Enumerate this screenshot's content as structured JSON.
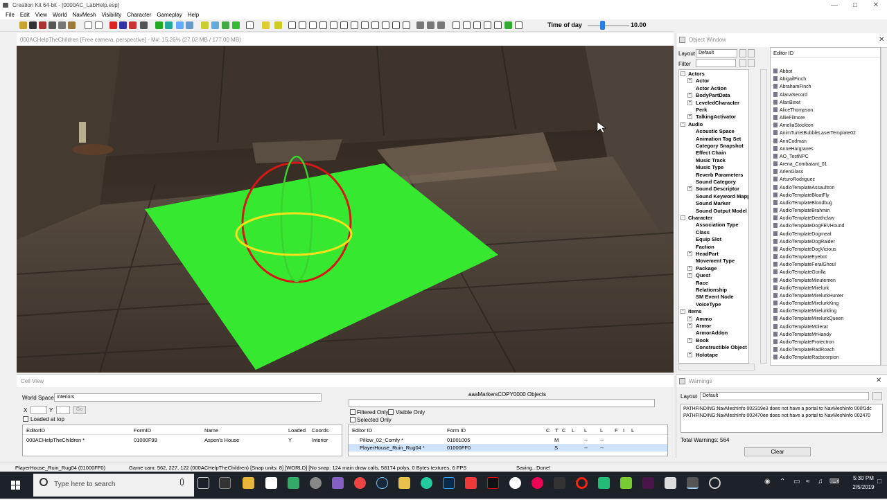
{
  "app": {
    "title": "Creation Kit 64-bit - [0000AC_LabHelp.esp]"
  },
  "menu": [
    "File",
    "Edit",
    "View",
    "World",
    "NavMesh",
    "Visibility",
    "Character",
    "Gameplay",
    "Help"
  ],
  "toolbar": {
    "time_of_day_label": "Time of day",
    "time_of_day_value": "10.00",
    "time_of_day_fraction": 0.35
  },
  "render_window": {
    "title": "000ACHelpTheChildren [Free camera, perspective] - M#: 15.26% (27.02 MB / 177.00 MB)"
  },
  "object_window": {
    "title": "Object Window",
    "layout_label": "Layout",
    "layout_value": "Default",
    "filter_label": "Filter",
    "list_header": "Editor ID",
    "tree": [
      {
        "label": "Actors",
        "level": 0,
        "expander": "-"
      },
      {
        "label": "Actor",
        "level": 1,
        "expander": "+"
      },
      {
        "label": "Actor Action",
        "level": 1,
        "expander": ""
      },
      {
        "label": "BodyPartData",
        "level": 1,
        "expander": "+"
      },
      {
        "label": "LeveledCharacter",
        "level": 1,
        "expander": "+"
      },
      {
        "label": "Perk",
        "level": 1,
        "expander": ""
      },
      {
        "label": "TalkingActivator",
        "level": 1,
        "expander": "+"
      },
      {
        "label": "Audio",
        "level": 0,
        "expander": "-"
      },
      {
        "label": "Acoustic Space",
        "level": 1,
        "expander": ""
      },
      {
        "label": "Animation Tag Set",
        "level": 1,
        "expander": ""
      },
      {
        "label": "Category Snapshot",
        "level": 1,
        "expander": ""
      },
      {
        "label": "Effect Chain",
        "level": 1,
        "expander": ""
      },
      {
        "label": "Music Track",
        "level": 1,
        "expander": ""
      },
      {
        "label": "Music Type",
        "level": 1,
        "expander": ""
      },
      {
        "label": "Reverb Parameters",
        "level": 1,
        "expander": ""
      },
      {
        "label": "Sound Category",
        "level": 1,
        "expander": ""
      },
      {
        "label": "Sound Descriptor",
        "level": 1,
        "expander": "+"
      },
      {
        "label": "Sound Keyword Mapping",
        "level": 1,
        "expander": ""
      },
      {
        "label": "Sound Marker",
        "level": 1,
        "expander": ""
      },
      {
        "label": "Sound Output Model",
        "level": 1,
        "expander": ""
      },
      {
        "label": "Character",
        "level": 0,
        "expander": "-"
      },
      {
        "label": "Association Type",
        "level": 1,
        "expander": ""
      },
      {
        "label": "Class",
        "level": 1,
        "expander": ""
      },
      {
        "label": "Equip Slot",
        "level": 1,
        "expander": ""
      },
      {
        "label": "Faction",
        "level": 1,
        "expander": ""
      },
      {
        "label": "HeadPart",
        "level": 1,
        "expander": "+"
      },
      {
        "label": "Movement Type",
        "level": 1,
        "expander": ""
      },
      {
        "label": "Package",
        "level": 1,
        "expander": "+"
      },
      {
        "label": "Quest",
        "level": 1,
        "expander": "+"
      },
      {
        "label": "Race",
        "level": 1,
        "expander": ""
      },
      {
        "label": "Relationship",
        "level": 1,
        "expander": ""
      },
      {
        "label": "SM Event Node",
        "level": 1,
        "expander": ""
      },
      {
        "label": "VoiceType",
        "level": 1,
        "expander": ""
      },
      {
        "label": "Items",
        "level": 0,
        "expander": "-"
      },
      {
        "label": "Ammo",
        "level": 1,
        "expander": "+"
      },
      {
        "label": "Armor",
        "level": 1,
        "expander": "+"
      },
      {
        "label": "ArmorAddon",
        "level": 1,
        "expander": ""
      },
      {
        "label": "Book",
        "level": 1,
        "expander": "+"
      },
      {
        "label": "Constructible Object",
        "level": 1,
        "expander": ""
      },
      {
        "label": "Holotape",
        "level": 1,
        "expander": "+"
      }
    ],
    "items": [
      "Abbot",
      "AbigailFinch",
      "AbrahamFinch",
      "AlanaSecord",
      "AlanBinet",
      "AliceThompson",
      "AllieFilmore",
      "AmeliaStockton",
      "AnimTurretBubbleLaserTemplate02",
      "AnnCodman",
      "AnneHargraves",
      "AO_TestNPC",
      "Arena_Combatant_01",
      "ArlenGlass",
      "ArturoRodriguez",
      "AudioTemplateAssaultron",
      "AudioTemplateBloatFly",
      "AudioTemplateBloodbug",
      "AudioTemplateBrahmin",
      "AudioTemplateDeathclaw",
      "AudioTemplateDogFEVHound",
      "AudioTemplateDogmeat",
      "AudioTemplateDogRaider",
      "AudioTemplateDogVicious",
      "AudioTemplateEyebot",
      "AudioTemplateFeralGhoul",
      "AudioTemplateGorilla",
      "AudioTemplateMinutemen",
      "AudioTemplateMirelurk",
      "AudioTemplateMirelurkHunter",
      "AudioTemplateMirelurkKing",
      "AudioTemplateMirelurkling",
      "AudioTemplateMirelurkQueen",
      "AudioTemplateMolerat",
      "AudioTemplateMrHandy",
      "AudioTemplateProtectron",
      "AudioTemplateRadRoach",
      "AudioTemplateRadscorpion"
    ]
  },
  "cell_view": {
    "title": "Cell View",
    "world_space_label": "World Space",
    "world_space_value": "Interiors",
    "x_label": "X",
    "y_label": "Y",
    "go_label": "Go",
    "loaded_at_top_label": "Loaded at top",
    "objects_title": "aaaMarkersCOPY0000 Objects",
    "filtered_only_label": "Filtered Only",
    "visible_only_label": "Visible Only",
    "selected_only_label": "Selected Only",
    "cells_columns": [
      "EditorID",
      "FormID",
      "Name",
      "Loaded",
      "Coords"
    ],
    "cells_rows": [
      {
        "editor_id": "000ACHelpTheChildren *",
        "form_id": "01000F99",
        "name": "Aspen's House",
        "loaded": "Y",
        "coords": "Interior"
      }
    ],
    "objects_columns": [
      "Editor ID",
      "Form ID",
      "C",
      "T",
      "C",
      "L",
      "L",
      "L",
      "F",
      "I",
      "L"
    ],
    "objects_rows": [
      {
        "editor_id": "Pillow_02_Comfy *",
        "form_id": "01001005",
        "c": "M",
        "l": "--",
        "l2": "--"
      },
      {
        "editor_id": "PlayerHouse_Ruin_Rug04 *",
        "form_id": "01000FF0",
        "c": "S",
        "l": "--",
        "l2": "--"
      }
    ]
  },
  "warnings": {
    "title": "Warnings",
    "layout_label": "Layout",
    "layout_value": "Default",
    "messages": [
      "PATHFINDING:NavMeshInfo 002319e3 does not have a portal to NavMeshInfo 000f1dc",
      "PATHFINDING:NavMeshInfo 002470ee does not have a portal to NavMeshInfo 002470"
    ],
    "total": "Total Warnings: 564",
    "clear_label": "Clear"
  },
  "status": {
    "selection": "PlayerHouse_Ruin_Rug04 (01000FF0)",
    "camera": "Game cam: 562, 227, 122 (000ACHelpTheChildren) [Snap units: 8] [WORLD] [No snap: 124 main draw calls, 58174 polys, 0 Bytes textures, 6 FPS",
    "saving": "Saving...Done!"
  },
  "taskbar": {
    "search_placeholder": "Type here to search",
    "time": "5:30 PM",
    "date": "2/5/2019"
  },
  "colors": {
    "accent": "#2a7de1",
    "navmesh_green": "#36e82f",
    "gizmo_red": "#d41818",
    "gizmo_yellow": "#f5e21b",
    "taskbar": "#1d2229"
  }
}
